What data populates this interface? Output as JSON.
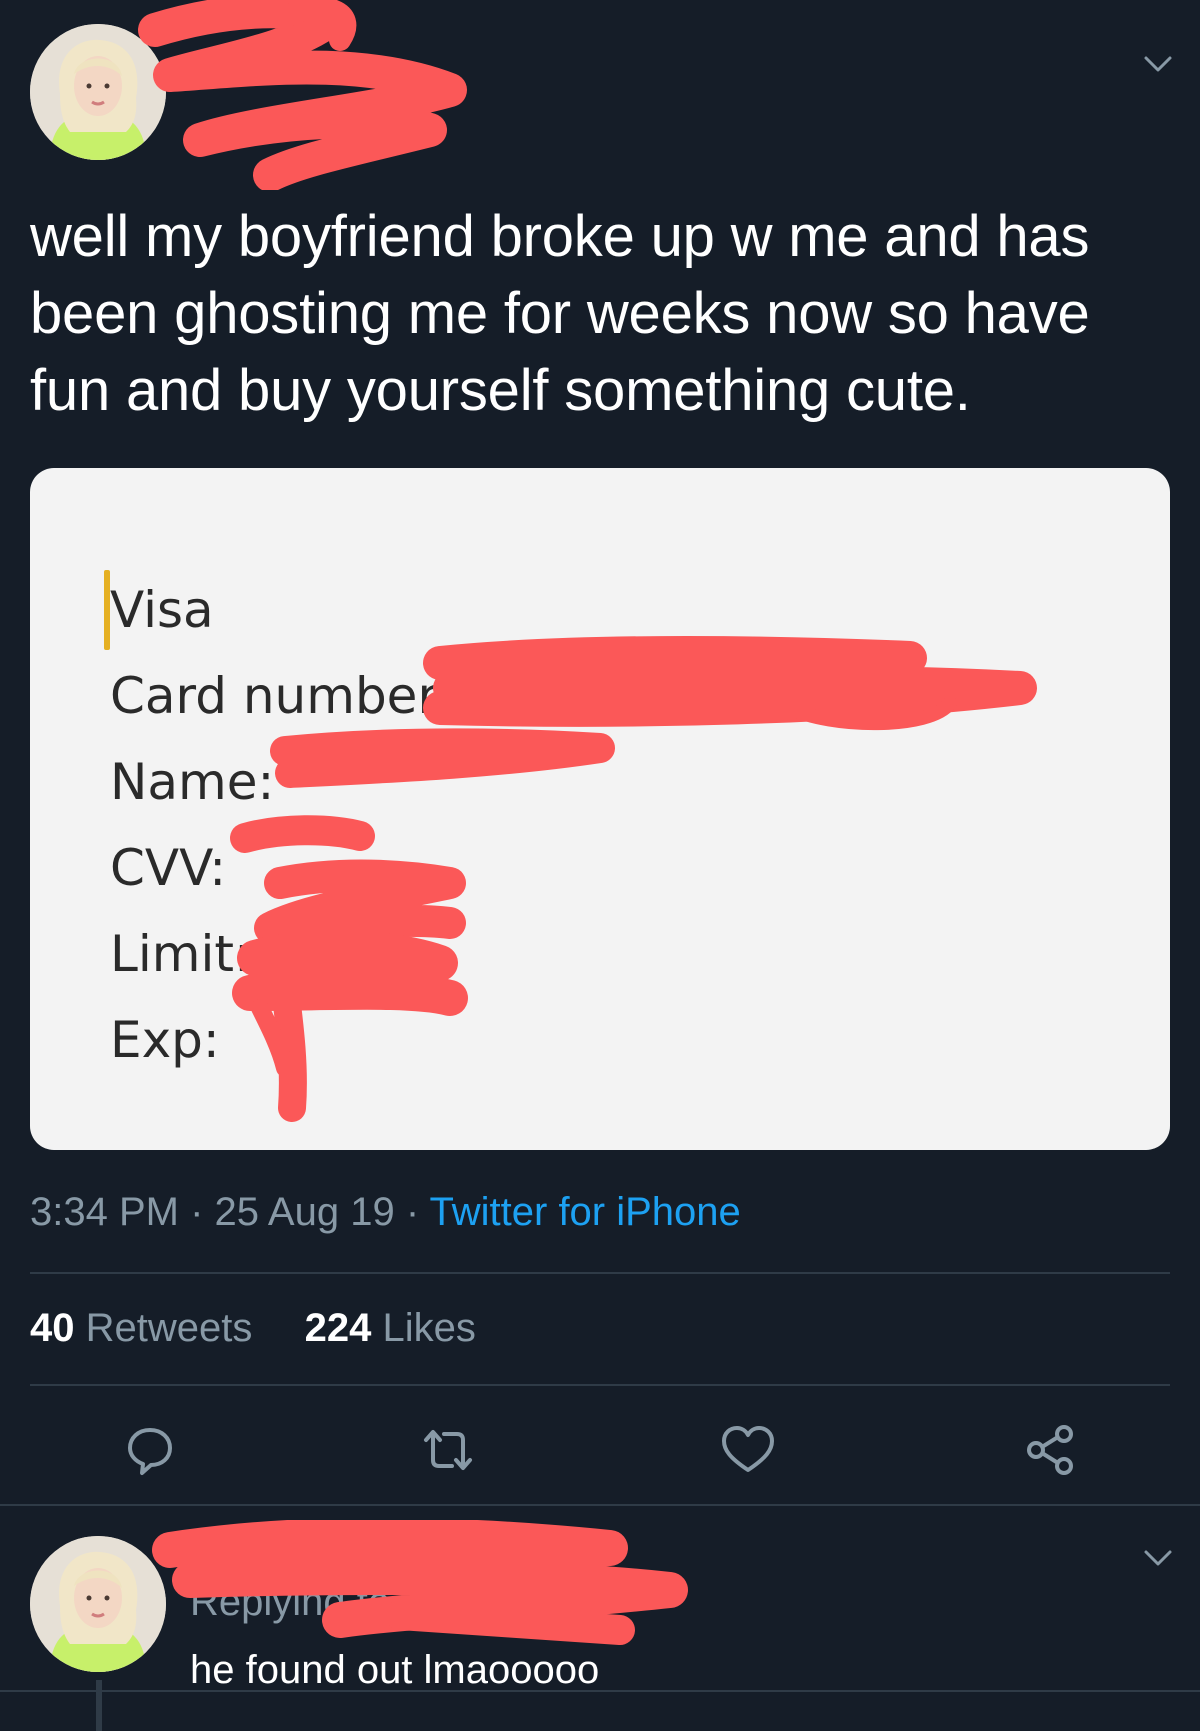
{
  "tweet": {
    "text": "well my boyfriend broke up w me and has been ghosting me for weeks now so have fun and buy yourself something cute.",
    "time": "3:34 PM",
    "sep1": " · ",
    "date": "25 Aug 19",
    "sep2": " · ",
    "source": "Twitter for iPhone",
    "retweets_count": "40",
    "retweets_label": "Retweets",
    "likes_count": "224",
    "likes_label": "Likes"
  },
  "note": {
    "line1": "Visa",
    "line2": "Card number",
    "line3": "Name:",
    "line4": "CVV:",
    "line5": "Limit:",
    "line6": "Exp:"
  },
  "reply": {
    "replying_label": "Replying to",
    "text": "he found out lmaooooo"
  },
  "colors": {
    "background": "#151d28",
    "accent": "#1da1f2",
    "redaction": "#fb5858",
    "muted": "#8899a6"
  },
  "icons": [
    "chevron-down-icon",
    "reply-icon",
    "retweet-icon",
    "like-icon",
    "share-icon"
  ]
}
